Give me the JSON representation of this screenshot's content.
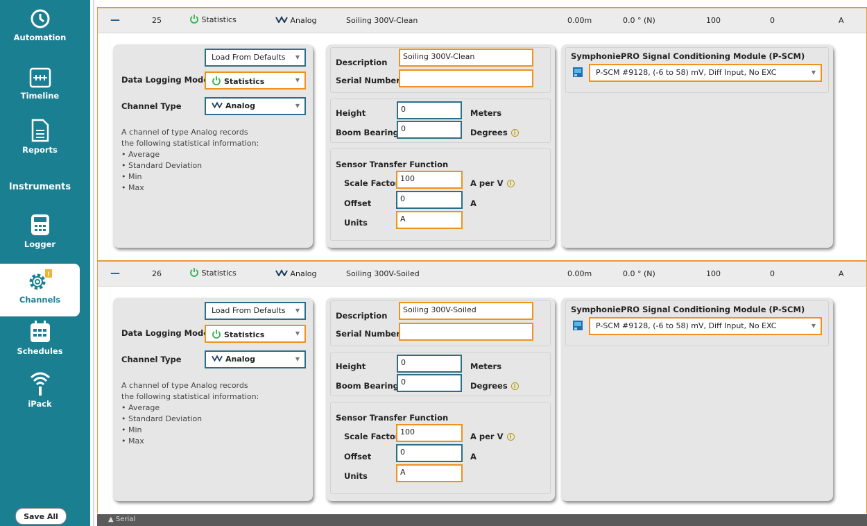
{
  "sidebar": {
    "items": [
      {
        "label": "Automation",
        "icon": "automation-icon"
      },
      {
        "label": "Timeline",
        "icon": "timeline-icon"
      },
      {
        "label": "Reports",
        "icon": "reports-icon"
      },
      {
        "label": "Logger",
        "icon": "logger-icon"
      },
      {
        "label": "Channels",
        "icon": "gear-icon"
      },
      {
        "label": "Schedules",
        "icon": "calendar-icon"
      },
      {
        "label": "iPack",
        "icon": "wifi-icon"
      }
    ],
    "section": "Instruments",
    "save_label": "Save All"
  },
  "channels": [
    {
      "number": "25",
      "mode": "Statistics",
      "type": "Analog",
      "description": "Soiling 300V-Clean",
      "height_col": "0.00m",
      "bearing_col": "0.0 ° (N)",
      "scale_col": "100",
      "offset_col": "0",
      "units_col": "A",
      "load_defaults": "Load From Defaults",
      "data_logging_mode_label": "Data Logging Mode",
      "channel_type_label": "Channel Type",
      "info": [
        "A channel of type Analog records",
        "the following statistical information:",
        "• Average",
        "• Standard Deviation",
        "• Min",
        "• Max"
      ],
      "description_label": "Description",
      "serial_label": "Serial Number",
      "serial_value": "",
      "height_label": "Height",
      "height_value": "0",
      "height_unit": "Meters",
      "bearing_label": "Boom Bearing",
      "bearing_value": "0",
      "bearing_unit": "Degrees",
      "stf_label": "Sensor Transfer Function",
      "scale_label": "Scale Factor",
      "scale_value": "100",
      "scale_unit": "A per V",
      "offset_label": "Offset",
      "offset_value": "0",
      "offset_unit": "A",
      "units_label": "Units",
      "units_value": "A",
      "module_title": "SymphoniePRO Signal Conditioning Module (P-SCM)",
      "module_value": "P-SCM #9128, (-6 to 58) mV, Diff Input, No EXC"
    },
    {
      "number": "26",
      "mode": "Statistics",
      "type": "Analog",
      "description": "Soiling 300V-Soiled",
      "height_col": "0.00m",
      "bearing_col": "0.0 ° (N)",
      "scale_col": "100",
      "offset_col": "0",
      "units_col": "A",
      "load_defaults": "Load From Defaults",
      "data_logging_mode_label": "Data Logging Mode",
      "channel_type_label": "Channel Type",
      "info": [
        "A channel of type Analog records",
        "the following statistical information:",
        "• Average",
        "• Standard Deviation",
        "• Min",
        "• Max"
      ],
      "description_label": "Description",
      "serial_label": "Serial Number",
      "serial_value": "",
      "height_label": "Height",
      "height_value": "0",
      "height_unit": "Meters",
      "bearing_label": "Boom Bearing",
      "bearing_value": "0",
      "bearing_unit": "Degrees",
      "stf_label": "Sensor Transfer Function",
      "scale_label": "Scale Factor",
      "scale_value": "100",
      "scale_unit": "A per V",
      "offset_label": "Offset",
      "offset_value": "0",
      "offset_unit": "A",
      "units_label": "Units",
      "units_value": "A",
      "module_title": "SymphoniePRO Signal Conditioning Module (P-SCM)",
      "module_value": "P-SCM #9128, (-6 to 58) mV, Diff Input, No EXC"
    }
  ],
  "serial_section": "Serial",
  "colors": {
    "accent": "#f0911e",
    "sidebar": "#1b7f92",
    "input_border": "#2c6e87",
    "power_green": "#2db34a"
  }
}
